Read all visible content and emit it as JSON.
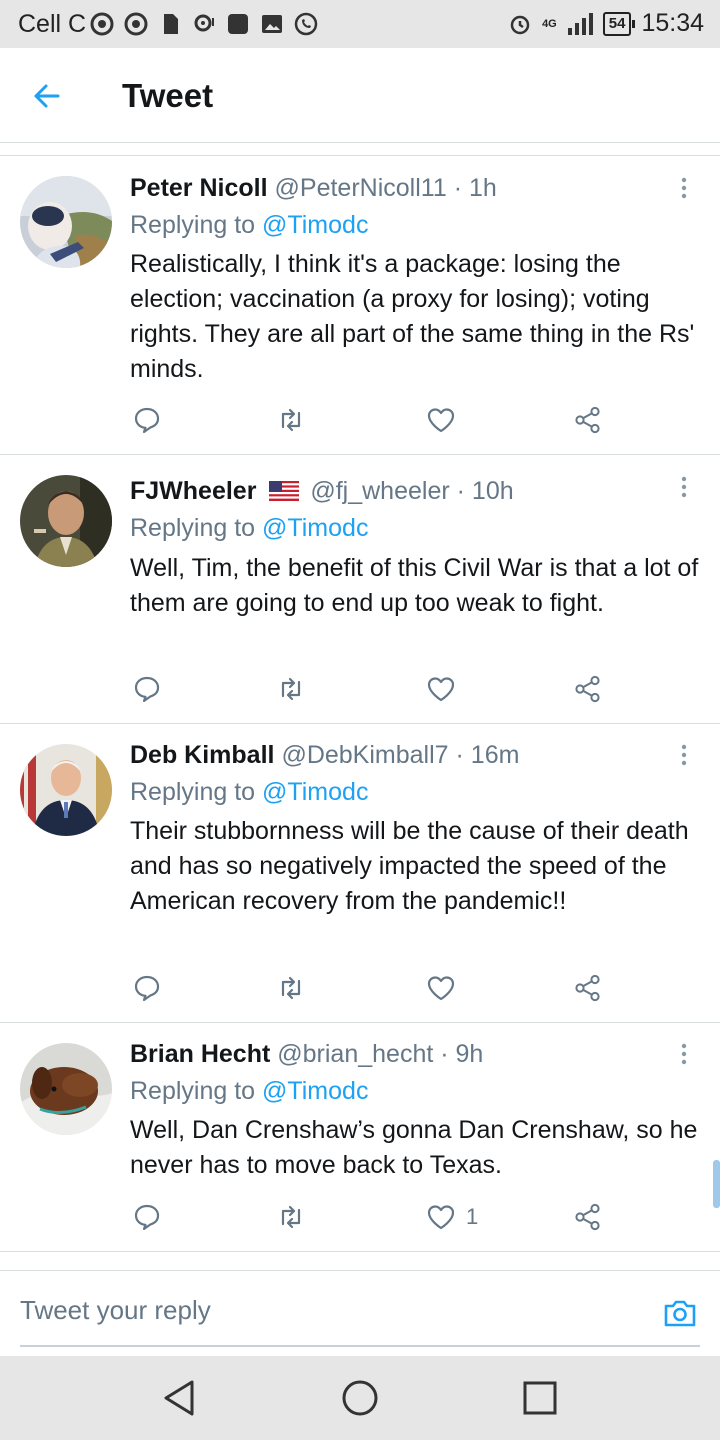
{
  "status_bar": {
    "carrier": "Cell C",
    "network": "4G",
    "battery": "54",
    "time": "15:34"
  },
  "header": {
    "title": "Tweet"
  },
  "colors": {
    "accent": "#1da1f2",
    "secondary_text": "#657786",
    "primary_text": "#14171a",
    "divider": "#d8dde0"
  },
  "tweets": [
    {
      "name": "Peter Nicoll",
      "handle": "@PeterNicoll11",
      "dot": "·",
      "time": "1h",
      "replying_prefix": "Replying to",
      "replying_to": "@Timodc",
      "text": "Realistically, I think it's a package: losing the election; vaccination (a proxy for losing); voting rights. They are all part of the same thing in the Rs' minds.",
      "like_count": ""
    },
    {
      "name": "FJWheeler",
      "handle": "@fj_wheeler",
      "dot": "·",
      "time": "10h",
      "replying_prefix": "Replying to",
      "replying_to": "@Timodc",
      "text": "Well, Tim, the benefit of this Civil War is that a lot of them are going to end up too weak to fight.",
      "like_count": ""
    },
    {
      "name": "Deb Kimball",
      "handle": "@DebKimball7",
      "dot": "·",
      "time": "16m",
      "replying_prefix": "Replying to",
      "replying_to": "@Timodc",
      "text": "Their stubbornness will be the cause of their death and has so negatively impacted the speed of the American recovery from the pandemic!!",
      "like_count": ""
    },
    {
      "name": "Brian Hecht",
      "handle": "@brian_hecht",
      "dot": "·",
      "time": "9h",
      "replying_prefix": "Replying to",
      "replying_to": "@Timodc",
      "text": "Well, Dan Crenshaw’s gonna Dan Crenshaw, so he never has to move back to Texas.",
      "like_count": "1"
    }
  ],
  "reply_bar": {
    "placeholder": "Tweet your reply"
  }
}
